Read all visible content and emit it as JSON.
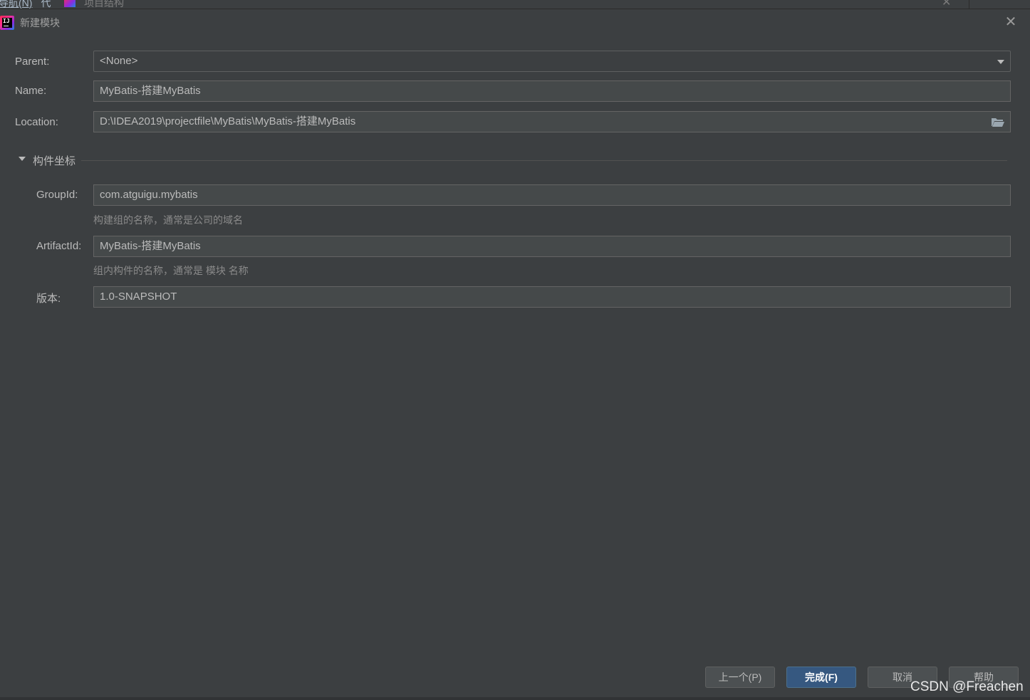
{
  "background": {
    "menu_nav": "导航(N)",
    "menu_code": "代",
    "window_title": "项目结构"
  },
  "dialog": {
    "title": "新建模块"
  },
  "form": {
    "parent_label": "Parent:",
    "parent_value": "<None>",
    "name_label": "Name:",
    "name_value": "MyBatis-搭建MyBatis",
    "location_label": "Location:",
    "location_value": "D:\\IDEA2019\\projectfile\\MyBatis\\MyBatis-搭建MyBatis"
  },
  "artifact_section": {
    "title": "构件坐标",
    "expanded": true,
    "groupid_label": "GroupId:",
    "groupid_value": "com.atguigu.mybatis",
    "groupid_hint": "构建组的名称，通常是公司的域名",
    "artifactid_label": "ArtifactId:",
    "artifactid_value": "MyBatis-搭建MyBatis",
    "artifactid_hint": "组内构件的名称，通常是 模块 名称",
    "version_label": "版本:",
    "version_value": "1.0-SNAPSHOT"
  },
  "buttons": {
    "previous": "上一个(P)",
    "finish": "完成(F)",
    "cancel": "取消",
    "help": "帮助"
  },
  "watermark": "CSDN @Freachen",
  "icons": {
    "app": "intellij-idea-icon",
    "close": "close-icon",
    "dropdown": "chevron-down-icon",
    "browse": "folder-icon",
    "section": "triangle-down-icon"
  },
  "colors": {
    "background": "#3c3f41",
    "field_background": "#45494a",
    "primary_button": "#365880",
    "text": "#bbbbbb",
    "hint_text": "#8a8a8a"
  }
}
